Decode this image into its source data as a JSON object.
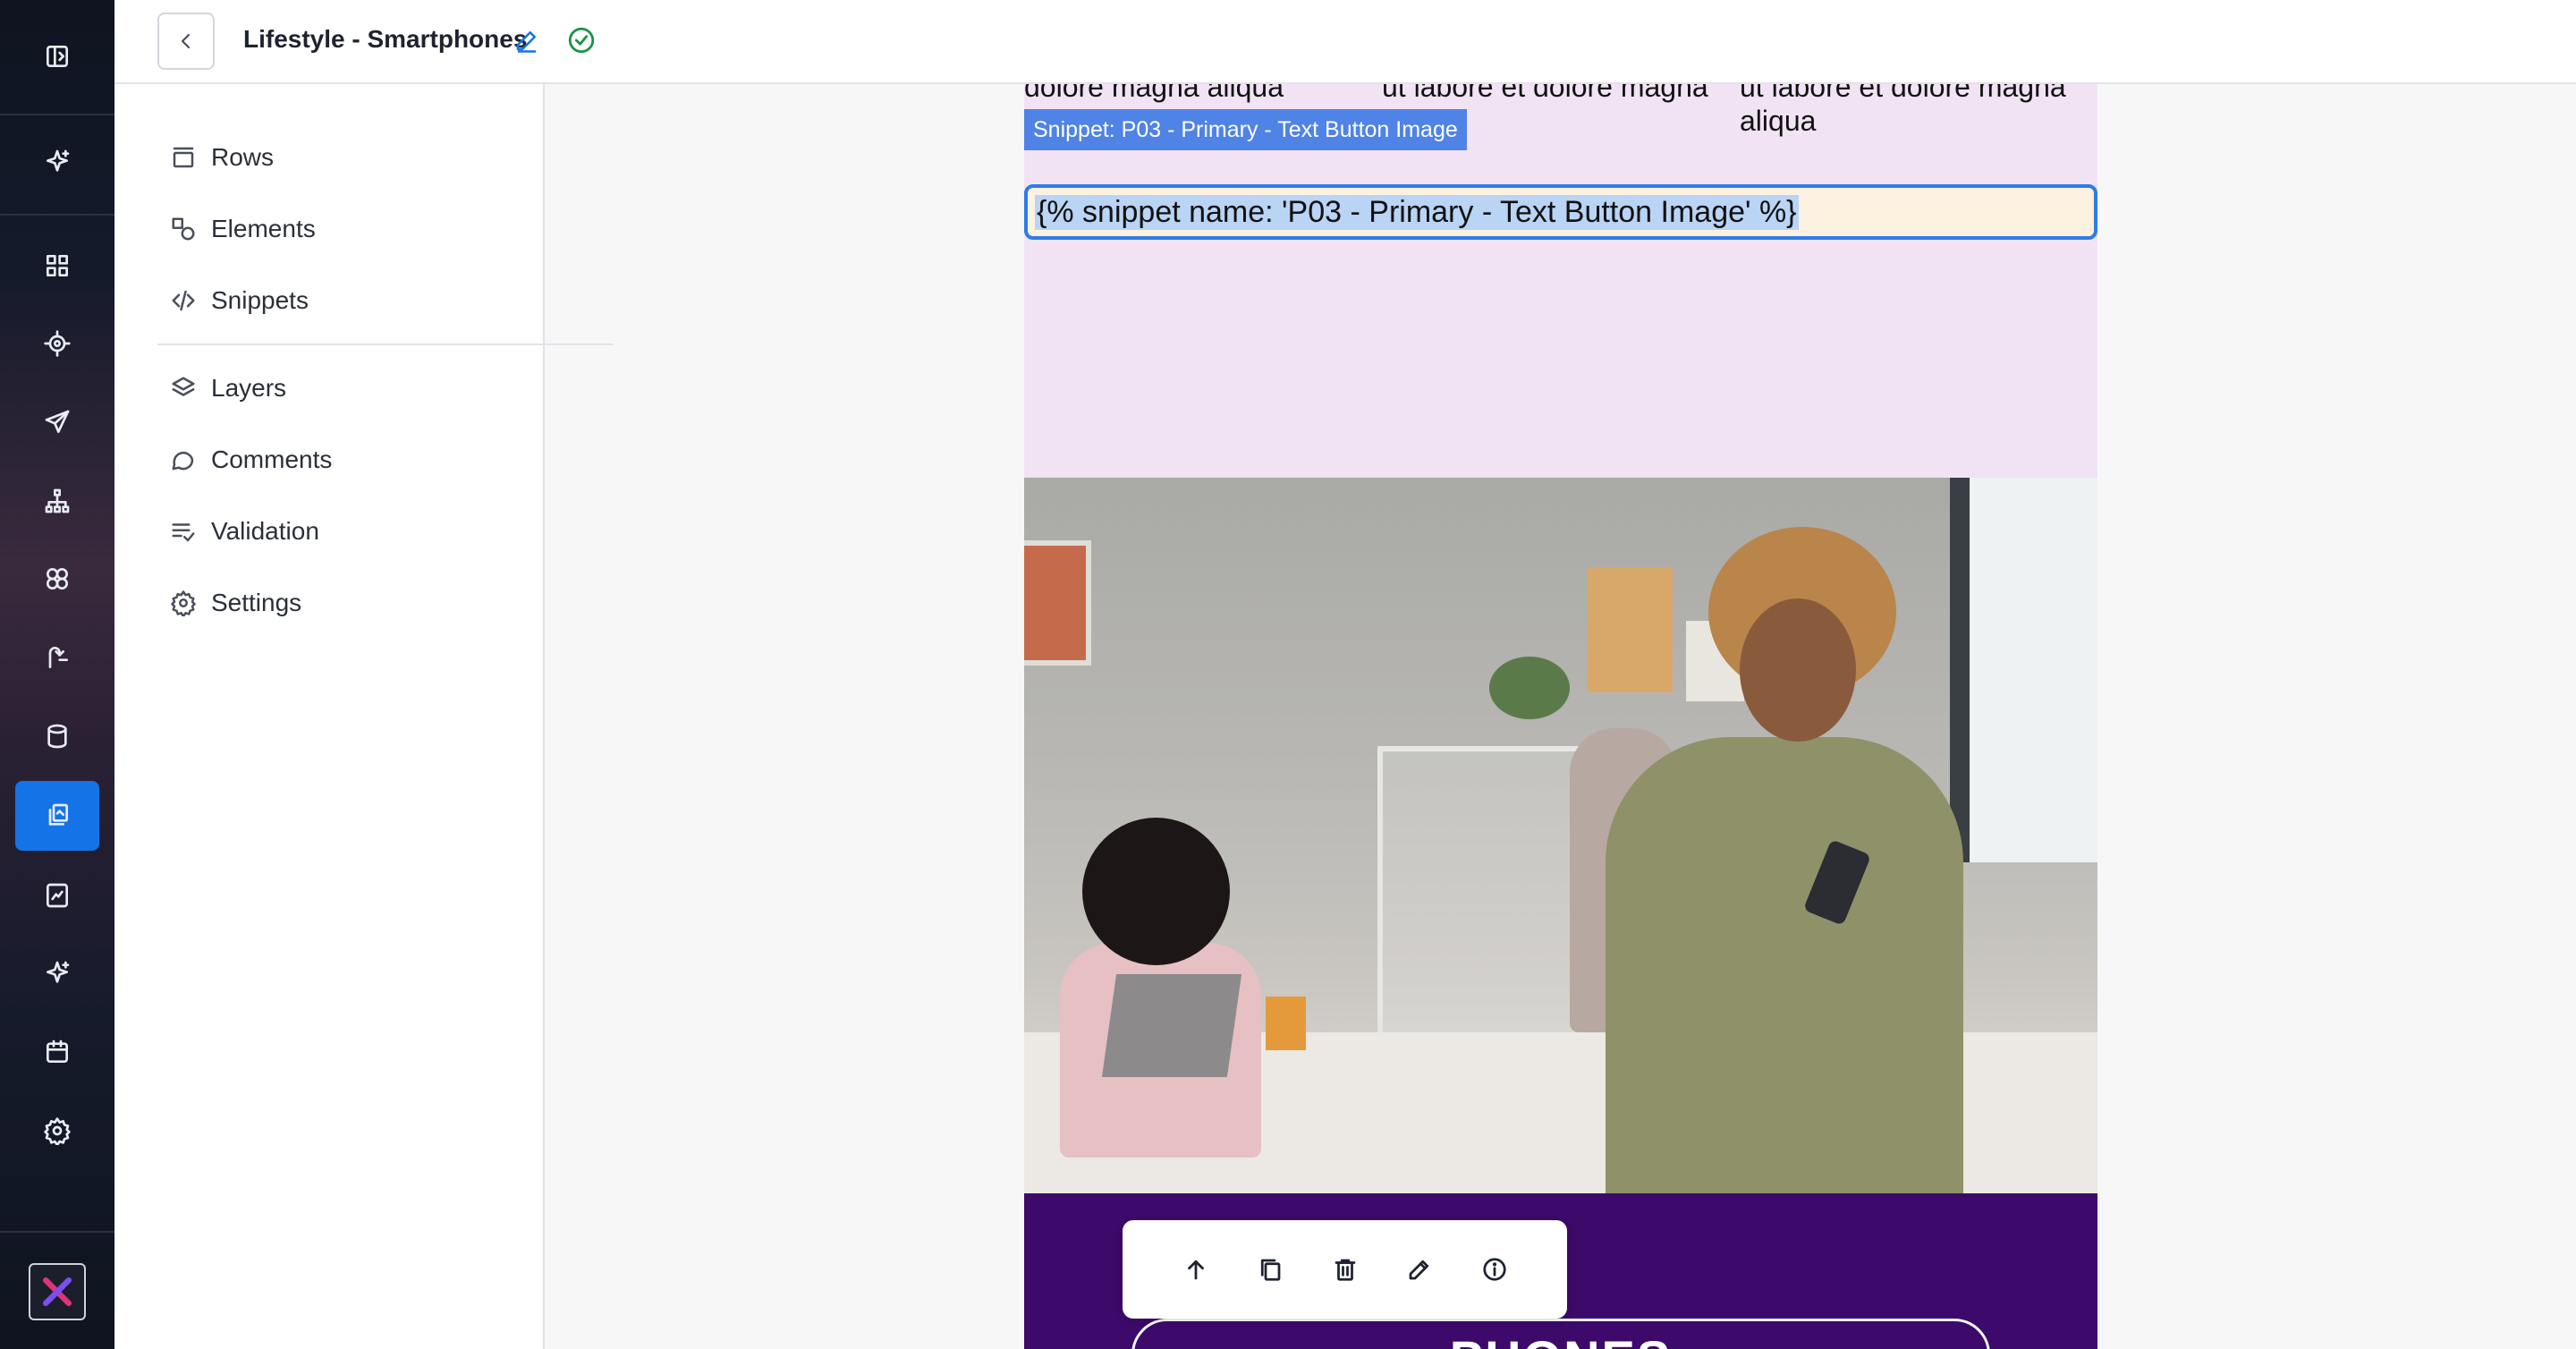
{
  "app": {
    "title": "Lifestyle - Smartphones",
    "status": "saved",
    "accent_color": "#1473e6"
  },
  "rail": {
    "items": [
      {
        "name": "sidebar-toggle-icon"
      },
      {
        "name": "ai-sparkle-icon"
      },
      {
        "name": "dashboard-grid-icon"
      },
      {
        "name": "target-icon"
      },
      {
        "name": "send-icon"
      },
      {
        "name": "hierarchy-icon"
      },
      {
        "name": "components-icon"
      },
      {
        "name": "journey-icon"
      },
      {
        "name": "database-icon"
      },
      {
        "name": "content-icon",
        "active": true
      },
      {
        "name": "reports-icon"
      },
      {
        "name": "sparkle-icon"
      },
      {
        "name": "calendar-icon"
      },
      {
        "name": "settings-gear-icon"
      }
    ]
  },
  "sidepanel": {
    "items": [
      {
        "label": "Rows",
        "icon": "rows-icon"
      },
      {
        "label": "Elements",
        "icon": "elements-icon"
      },
      {
        "label": "Snippets",
        "icon": "code-icon"
      },
      {
        "label": "Layers",
        "icon": "layers-icon"
      },
      {
        "label": "Comments",
        "icon": "comment-icon"
      },
      {
        "label": "Validation",
        "icon": "validation-icon"
      },
      {
        "label": "Settings",
        "icon": "gear-icon"
      }
    ]
  },
  "email": {
    "col1_text": "dolore magna aliqua",
    "col2_text": "ut labore et dolore magna a",
    "col3_text": "ut labore et dolore magna aliqua",
    "snippet_tag": "Snippet: P03 - Primary - Text Button Image",
    "snippet_code": "{% snippet name: 'P03 - Primary - Text Button Image' %}",
    "cta_text": "PHONES",
    "bottom_bg": "#3d0a6b",
    "top_bg": "#f1e3f4"
  },
  "toolbar": {
    "buttons": [
      "move-up-icon",
      "duplicate-icon",
      "delete-icon",
      "edit-icon",
      "info-icon"
    ]
  }
}
